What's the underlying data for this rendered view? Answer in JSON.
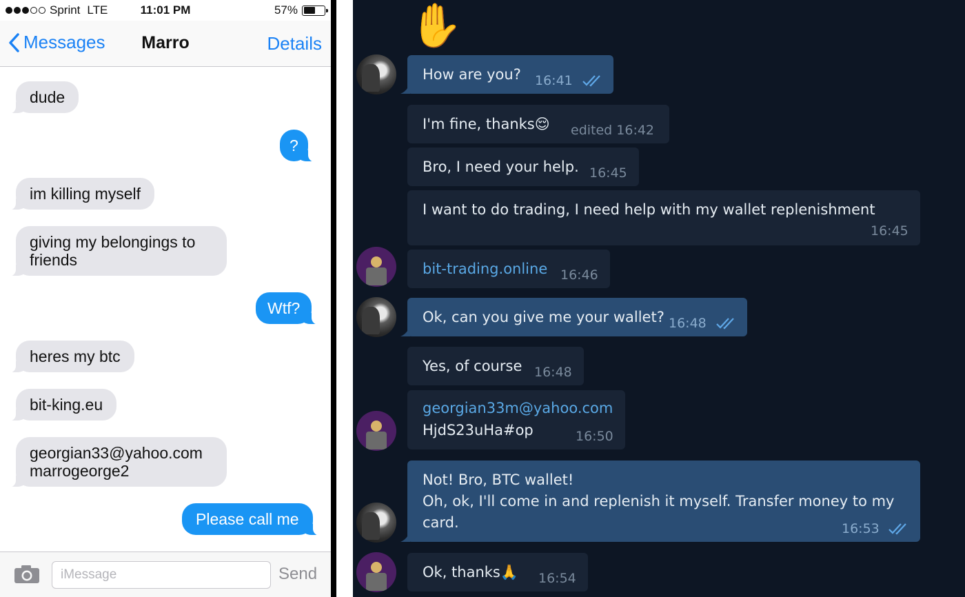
{
  "ios": {
    "status": {
      "carrier": "Sprint",
      "network": "LTE",
      "time": "11:01 PM",
      "battery": "57%",
      "battery_level": 0.57
    },
    "nav": {
      "back_label": "Messages",
      "title": "Marro",
      "details_label": "Details"
    },
    "messages": [
      {
        "dir": "in",
        "text": "dude"
      },
      {
        "dir": "out",
        "text": "?"
      },
      {
        "dir": "in",
        "text": "im killing myself"
      },
      {
        "dir": "in",
        "text": "giving my belongings to",
        "text2": "friends"
      },
      {
        "dir": "out",
        "text": "Wtf?"
      },
      {
        "dir": "in",
        "text": "heres my btc"
      },
      {
        "dir": "in",
        "text": "bit-king.eu"
      },
      {
        "dir": "in",
        "text": "georgian33@yahoo.com",
        "text2": "marrogeorge2"
      },
      {
        "dir": "out",
        "text": "Please call me"
      }
    ],
    "compose": {
      "placeholder": "iMessage",
      "send_label": "Send"
    }
  },
  "telegram": {
    "messages": [
      {
        "dir": "out",
        "text": "How are you?",
        "time": "16:41",
        "read": true
      },
      {
        "dir": "in",
        "text": "I'm fine, thanks",
        "emoji": "😌",
        "time": "edited 16:42"
      },
      {
        "dir": "in",
        "text": "Bro, I need your help.",
        "time": "16:45"
      },
      {
        "dir": "in",
        "text": "I want to do trading, I need help with my wallet replenishment",
        "time": "16:45"
      },
      {
        "dir": "in",
        "text": "bit-trading.online",
        "time": "16:46",
        "link": true
      },
      {
        "dir": "out",
        "text": "Ok, can you give me your wallet?",
        "time": "16:48",
        "read": true
      },
      {
        "dir": "in",
        "text": "Yes, of course",
        "time": "16:48"
      },
      {
        "dir": "in",
        "text": "georgian33m@yahoo.com",
        "text2": "HjdS23uHa#op",
        "time": "16:50"
      },
      {
        "dir": "out",
        "text": "Not! Bro, BTC wallet!",
        "text2": "Oh, ok, I'll come in and replenish it myself. Transfer money to my",
        "text3": "card.",
        "time": "16:53",
        "read": true
      },
      {
        "dir": "in",
        "text": "Ok, thanks",
        "emoji": "🙏",
        "time": "16:54"
      }
    ],
    "hand_emoji": "✋"
  }
}
